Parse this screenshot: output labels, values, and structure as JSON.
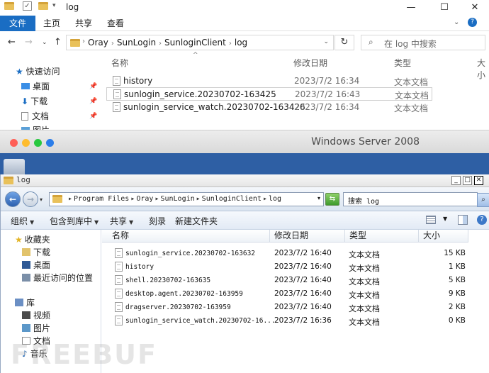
{
  "top_window": {
    "title": "log",
    "quick_access_icons": [
      "folder-icon",
      "checkbox-icon",
      "folder-icon",
      "dropdown-icon"
    ],
    "window_controls": {
      "minimize": "—",
      "maximize": "☐",
      "close": "✕"
    },
    "ribbon_tabs": [
      {
        "label": "文件"
      },
      {
        "label": "主页"
      },
      {
        "label": "共享"
      },
      {
        "label": "查看"
      }
    ],
    "address_path": [
      "Oray",
      "SunLogin",
      "SunloginClient",
      "log"
    ],
    "search_placeholder": "在 log 中搜索",
    "nav_items": [
      {
        "label": "快速访问",
        "icon": "star-icon"
      },
      {
        "label": "桌面",
        "icon": "desktop-icon",
        "pinned": true
      },
      {
        "label": "下载",
        "icon": "download-icon",
        "pinned": true
      },
      {
        "label": "文档",
        "icon": "document-icon",
        "pinned": true
      },
      {
        "label": "图片",
        "icon": "picture-icon"
      }
    ],
    "columns": {
      "name": "名称",
      "date": "修改日期",
      "type": "类型",
      "size": "大小"
    },
    "files": [
      {
        "name": "history",
        "date": "2023/7/2 16:34",
        "type": "文本文档"
      },
      {
        "name": "sunlogin_service.20230702-163425",
        "date": "2023/7/2 16:43",
        "type": "文本文档"
      },
      {
        "name": "sunlogin_service_watch.20230702-163426",
        "date": "2023/7/2 16:34",
        "type": "文本文档"
      }
    ]
  },
  "mac_bar": {
    "title": "Windows Server 2008",
    "dot_colors": [
      "#ff5f57",
      "#febc2e",
      "#28c840",
      "#2b7de9"
    ]
  },
  "bottom_window": {
    "title": "log",
    "window_controls": {
      "minimize": "_",
      "maximize": "□",
      "close": "✕"
    },
    "address_path": [
      "Program Files",
      "Oray",
      "SunLogin",
      "SunloginClient",
      "log"
    ],
    "search_placeholder": "搜索 log",
    "toolbar": [
      {
        "label": "组织",
        "dropdown": true
      },
      {
        "label": "包含到库中",
        "dropdown": true
      },
      {
        "label": "共享",
        "dropdown": true
      },
      {
        "label": "刻录",
        "dropdown": false
      },
      {
        "label": "新建文件夹",
        "dropdown": false
      }
    ],
    "nav_items": [
      {
        "label": "收藏夹",
        "icon": "star-icon",
        "group": true
      },
      {
        "label": "下载",
        "icon": "download-folder-icon"
      },
      {
        "label": "桌面",
        "icon": "desktop-icon"
      },
      {
        "label": "最近访问的位置",
        "icon": "recent-places-icon"
      },
      {
        "label": "库",
        "icon": "library-icon",
        "group": true
      },
      {
        "label": "视频",
        "icon": "video-icon"
      },
      {
        "label": "图片",
        "icon": "picture-icon"
      },
      {
        "label": "文档",
        "icon": "document-icon"
      },
      {
        "label": "音乐",
        "icon": "music-icon"
      }
    ],
    "columns": {
      "name": "名称",
      "date": "修改日期",
      "type": "类型",
      "size": "大小"
    },
    "files": [
      {
        "name": "sunlogin_service.20230702-163632",
        "date": "2023/7/2 16:40",
        "type": "文本文档",
        "size": "15 KB"
      },
      {
        "name": "history",
        "date": "2023/7/2 16:40",
        "type": "文本文档",
        "size": "1 KB"
      },
      {
        "name": "shell.20230702-163635",
        "date": "2023/7/2 16:40",
        "type": "文本文档",
        "size": "5 KB"
      },
      {
        "name": "desktop.agent.20230702-163959",
        "date": "2023/7/2 16:40",
        "type": "文本文档",
        "size": "9 KB"
      },
      {
        "name": "dragserver.20230702-163959",
        "date": "2023/7/2 16:40",
        "type": "文本文档",
        "size": "2 KB"
      },
      {
        "name": "sunlogin_service_watch.20230702-16...",
        "date": "2023/7/2 16:36",
        "type": "文本文档",
        "size": "0 KB"
      }
    ]
  },
  "watermark": "FREEBUF"
}
